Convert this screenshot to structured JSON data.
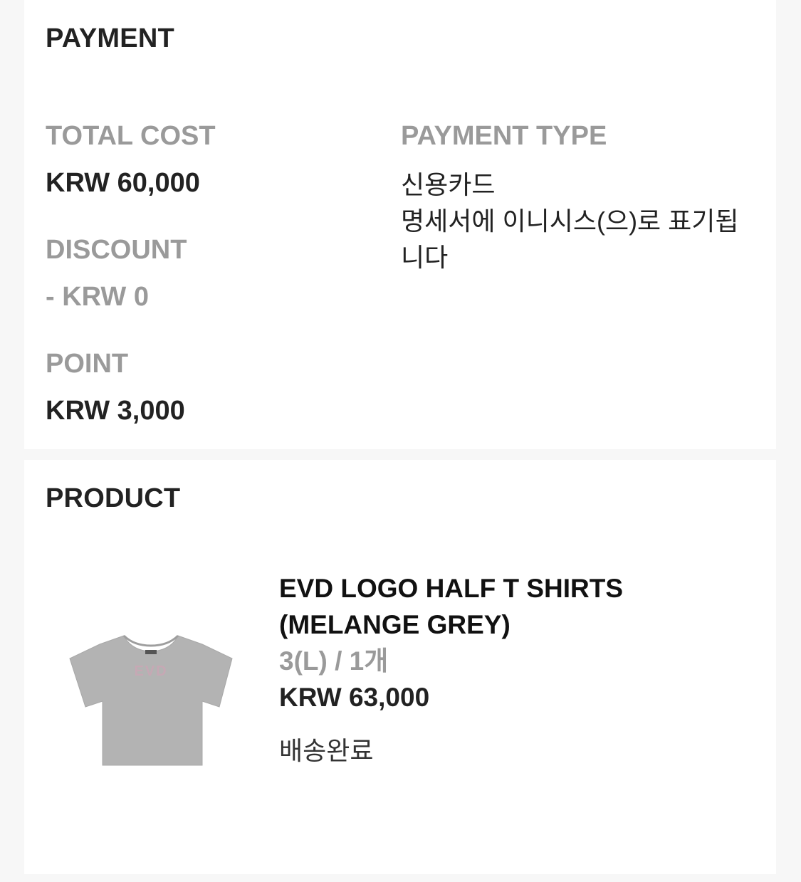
{
  "payment": {
    "title": "PAYMENT",
    "total_cost_label": "TOTAL COST",
    "total_cost_value": "KRW 60,000",
    "discount_label": "DISCOUNT",
    "discount_value": "- KRW 0",
    "point_label": "POINT",
    "point_value": "KRW 3,000",
    "payment_type_label": "PAYMENT TYPE",
    "payment_type_lines": [
      "신용카드",
      "명세서에 이니시스(으)로 표기됩",
      "니다"
    ]
  },
  "product": {
    "title": "PRODUCT",
    "item": {
      "name": "EVD LOGO HALF T SHIRTS (MELANGE GREY)",
      "option": "3(L) / 1개",
      "price": "KRW 63,000",
      "status": "배송완료",
      "thumbnail_icon": "tshirt-image"
    }
  },
  "colors": {
    "background": "#f7f7f7",
    "card": "#ffffff",
    "text_primary": "#222222",
    "text_muted": "#9a9a9a",
    "shirt_grey": "#b3b3b3"
  }
}
